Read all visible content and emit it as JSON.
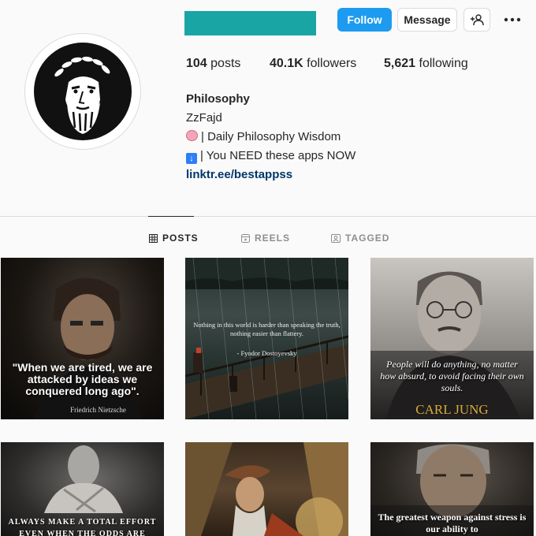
{
  "header": {
    "username_color": "#1aa5a5",
    "follow_label": "Follow",
    "message_label": "Message",
    "add_user_icon": "add-user-icon",
    "more_icon": "more-icon"
  },
  "stats": {
    "posts_count": "104",
    "posts_label": "posts",
    "followers_count": "40.1K",
    "followers_label": "followers",
    "following_count": "5,621",
    "following_label": "following"
  },
  "bio": {
    "name": "Philosophy",
    "handle": "ZzFajd",
    "line1": "| Daily Philosophy Wisdom",
    "line2": "| You NEED these apps NOW",
    "link": "linktr.ee/bestappss"
  },
  "tabs": [
    {
      "label": "POSTS",
      "icon": "grid-icon",
      "active": true
    },
    {
      "label": "REELS",
      "icon": "reels-icon",
      "active": false
    },
    {
      "label": "TAGGED",
      "icon": "tagged-icon",
      "active": false
    }
  ],
  "posts": [
    {
      "quote": "\"When we are tired, we are attacked by ideas we conquered long ago\".",
      "author": "Friedrich Nietzsche"
    },
    {
      "quote": "Nothing in this world is harder than speaking the truth, nothing easier than flattery.",
      "author": "- Fyodor Dostoyevsky"
    },
    {
      "quote": "People will do anything, no matter how absurd, to avoid facing their own souls.",
      "author": "CARL JUNG"
    },
    {
      "quote": "ALWAYS MAKE A TOTAL EFFORT EVEN WHEN THE ODDS ARE",
      "author": ""
    },
    {
      "quote": "",
      "author": ""
    },
    {
      "quote": "The greatest weapon against stress is our ability to",
      "author": ""
    }
  ]
}
